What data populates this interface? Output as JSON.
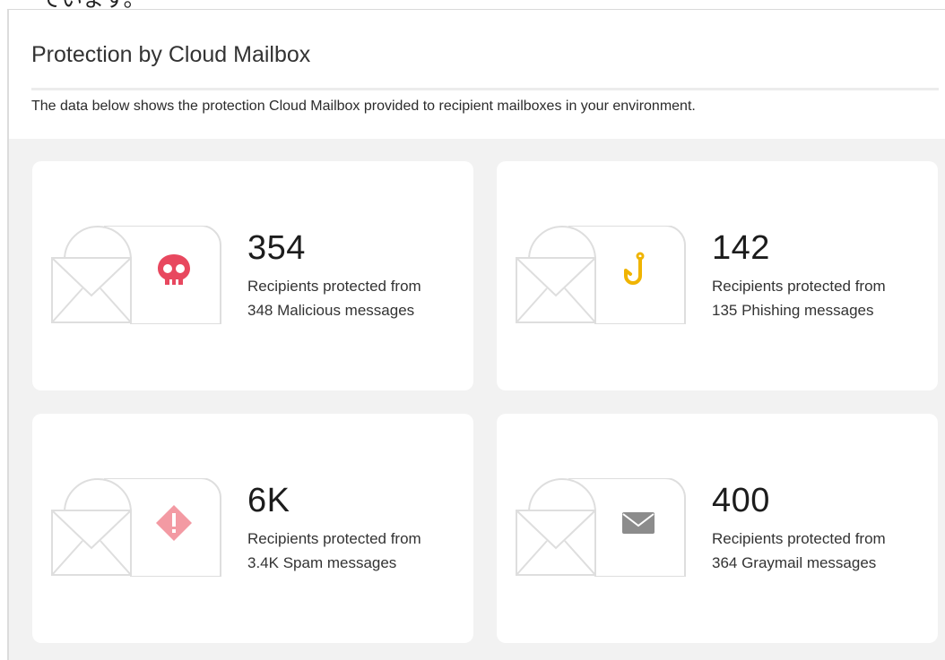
{
  "caption": "ています。",
  "panel": {
    "title": "Protection by Cloud Mailbox",
    "description": "The data below shows the protection Cloud Mailbox provided to recipient mailboxes in your environment."
  },
  "cards": [
    {
      "count": "354",
      "line1": "Recipients protected from",
      "line2": "348 Malicious messages",
      "icon": "skull-icon",
      "color": "#e8485f"
    },
    {
      "count": "142",
      "line1": "Recipients protected from",
      "line2": "135 Phishing messages",
      "icon": "fishhook-icon",
      "color": "#f0b400"
    },
    {
      "count": "6K",
      "line1": "Recipients protected from",
      "line2": "3.4K Spam messages",
      "icon": "warning-diamond-icon",
      "color": "#f39aa3"
    },
    {
      "count": "400",
      "line1": "Recipients protected from",
      "line2": "364 Graymail messages",
      "icon": "envelope-icon",
      "color": "#8c8c8c"
    }
  ]
}
